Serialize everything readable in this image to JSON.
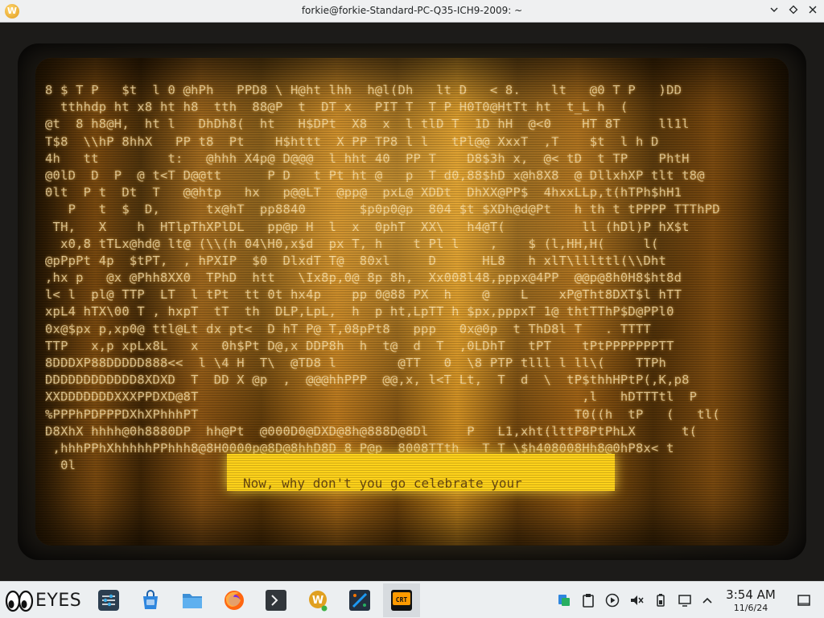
{
  "window": {
    "title": "forkie@forkie-Standard-PC-Q35-ICH9-2009: ~",
    "app_icon_letter": "W",
    "controls": [
      "minimize",
      "maximize",
      "close"
    ]
  },
  "crt": {
    "glyph_rows": [
      "8 $ T P   $t  l 0 @hPh   PPD8 \\ H@ht lhh  h@l(Dh   lt D   < 8.    lt   @0 T P   )DD",
      "  tthhdp ht x8 ht h8  tth  88@P  t  DT x   PIT T  T P H0T0@HtTt ht  t_L h  (  ",
      "@t  8 h8@H,  ht l   DhDh8(  ht   H$DPt  X8  x  l tlD T  1D hH  @<0    HT 8T     ll1l",
      "T$8  \\\\hP 8hhX   PP t8  Pt    H$httt  X PP TP8 l l   tPl@@ XxxT  ,T    $t  l h D",
      "4h   tt         t:   @hhh X4p@ D@@@  l hht 40  PP T    D8$3h x,  @< tD  t TP    PhtH",
      "@0lD  D  P  @ t<T D@@tt      P D   t Pt ht @   p  T d0,88$hD x@h8X8  @ DllxhXP tlt t8@",
      "0lt  P t  Dt  T   @@htp   hx   p@@LT  @pp@  pxL@ XDDt  DhXX@PP$  4hxxLLp,t(hTPh$hH1",
      "   P   t  $  D,      tx@hT  pp8840       $p0p0@p  804 $t $XDh@d@Pt   h th t tPPPP TTThPD",
      " TH,   X    h  HTlpThXPlDL   pp@p H  l  x  0phT  XX\\   h4@T(          ll (hDl)P hX$t",
      "  x0,8 tTLx@hd@ lt@ (\\\\(h 04\\H0,x$d  px T, h    t Pl l    ,    $ (l,HH,H(     l(",
      "@pPpPt 4p  $tPT,  , hPXIP  $0  DlxdT T@  80xl     D      HL8   h xlT\\lllttl(\\\\Dht",
      ",hx p   @x @Phh8XX0  TPhD  htt   \\Ix8p,0@ 8p 8h,  Xx008l48,pppx@4PP  @@p@8h0H8$ht8d",
      "l< l  pl@ TTP  LT  l tPt  tt 0t hx4p    pp 0@88 PX  h    @    L    xP@Tht8DXT$l hTT",
      "xpL4 hTX\\00 T , hxpT  tT  th  DLP,LpL,  h  p ht,LpTT h $px,pppxT 1@ thtTThP$D@PPl0",
      "0x@$px p,xp0@ ttl@Lt dx pt<  D hT P@ T,08pPt8   ppp   0x@0p  t ThD8l T   . TTTT",
      "TTP   x,p xpLx8L   x   0h$Pt D@,x DDP8h  h  t@  d  T  ,0LDhT   tPT    tPtPPPPPPPTT",
      "8DDDXP88DDDDD888<<  l \\4 H  T\\  @TD8 l        @TT   0  \\8 PTP tlll l ll\\(    TTPh",
      "DDDDDDDDDDDD8XDXD  T  DD X @p  ,  @@@hhPPP  @@,x, l<T Lt,  T  d  \\  tP$thhHPtP(,K,p8",
      "XXDDDDDDDXXXPPDXD@8T                                                  ,l   hDTTTtl  P",
      "%PPPhPDPPPDXhXPhhhPT                                                 T0((h  tP   (   tl(",
      "D8XhX hhhh@0h8880DP  hh@Pt  @000D0@DXD@8h@888D@8Dl     P   L1,xht(lttP8PtPhLX      t(",
      " ,hhhPPhXhhhhhPPhhh8@8H0000p@8D@8hhD8D 8 P@p  8008TTth   T T \\$h408008Hh8@0hP8x< t",
      "  0l"
    ],
    "dialog_text": "Now, why don't you go celebrate your"
  },
  "taskbar": {
    "launcher_label": "EYES",
    "tasks": [
      {
        "name": "system-settings",
        "icon": "settings-sliders-icon",
        "color": "#2c3e50"
      },
      {
        "name": "discover",
        "icon": "store-bag-icon",
        "color": "#2e86de"
      },
      {
        "name": "file-manager",
        "icon": "folder-icon",
        "color": "#3d8fd6"
      },
      {
        "name": "firefox",
        "icon": "firefox-icon",
        "color": "#ff6611"
      },
      {
        "name": "terminal",
        "icon": "terminal-icon",
        "color": "#31363b"
      },
      {
        "name": "wine-app",
        "icon": "wine-glass-icon",
        "color": "#e0a020"
      },
      {
        "name": "plasma-app",
        "icon": "paintbrush-icon",
        "color": "#1d99f3"
      },
      {
        "name": "cool-retro-term",
        "icon": "crt-icon",
        "color": "#ff9a00",
        "label": "CRT"
      }
    ],
    "tray": [
      "network-icon",
      "clipboard-icon",
      "media-play-icon",
      "volume-muted-icon",
      "battery-icon",
      "display-icon",
      "chevron-up-icon"
    ],
    "clock": {
      "time": "3:54 AM",
      "date": "11/6/24"
    },
    "show_desktop": "show-desktop-icon"
  }
}
